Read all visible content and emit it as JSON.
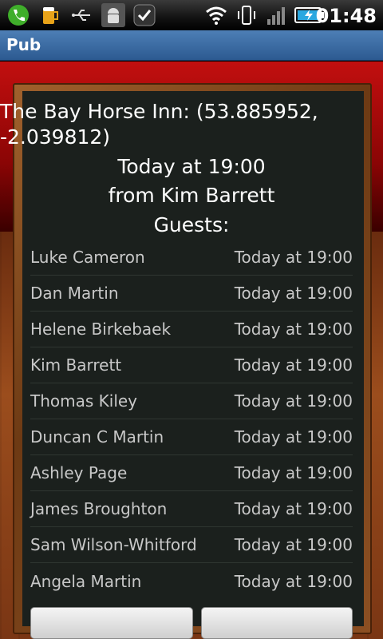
{
  "status_bar": {
    "time": "01:48",
    "icons": [
      "phone-icon",
      "beer-icon",
      "usb-icon",
      "android-debug-icon",
      "checkmark-icon",
      "wifi-icon",
      "vibrate-icon",
      "signal-icon",
      "battery-charging-icon"
    ]
  },
  "app": {
    "title": "Pub"
  },
  "pub": {
    "name_coords": "The Bay Horse Inn: (53.885952, -2.039812)",
    "when": "Today at 19:00",
    "from": "from Kim Barrett",
    "guests_label": "Guests:"
  },
  "guests": [
    {
      "name": "Luke Cameron",
      "time": "Today at 19:00"
    },
    {
      "name": "Dan Martin",
      "time": "Today at 19:00"
    },
    {
      "name": "Helene Birkebaek",
      "time": "Today at 19:00"
    },
    {
      "name": "Kim Barrett",
      "time": "Today at 19:00"
    },
    {
      "name": "Thomas Kiley",
      "time": "Today at 19:00"
    },
    {
      "name": "Duncan C Martin",
      "time": "Today at 19:00"
    },
    {
      "name": "Ashley Page",
      "time": "Today at 19:00"
    },
    {
      "name": "James Broughton",
      "time": "Today at 19:00"
    },
    {
      "name": "Sam Wilson-Whitford",
      "time": "Today at 19:00"
    },
    {
      "name": "Angela Martin",
      "time": "Today at 19:00"
    }
  ],
  "colors": {
    "titlebar": "#3d6ea6",
    "wall": "#b30d0d",
    "board": "#1b201d"
  }
}
